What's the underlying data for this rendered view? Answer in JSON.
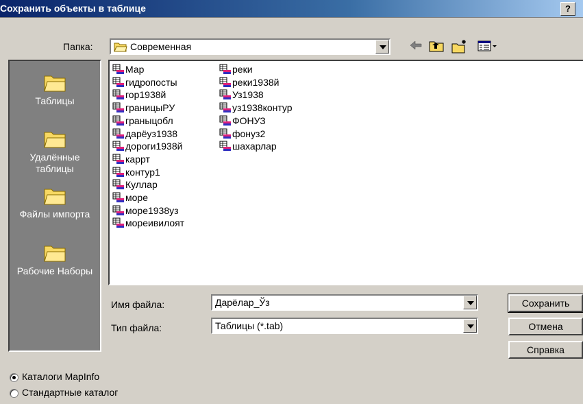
{
  "window": {
    "title": "Сохранить объекты в таблице",
    "help_label": "?"
  },
  "folder_bar": {
    "label": "Папка:",
    "current": "Современная"
  },
  "places": [
    {
      "name": "places-tables",
      "label": "Таблицы"
    },
    {
      "name": "places-remote",
      "label": "Удалённые таблицы"
    },
    {
      "name": "places-import",
      "label": "Файлы импорта"
    },
    {
      "name": "places-workspaces",
      "label": "Рабочие Наборы"
    }
  ],
  "files": {
    "column1": [
      "Мар",
      "гидропосты",
      "гор1938й",
      "границыРУ",
      "граныцобл",
      "дарёуз1938",
      "дороги1938й",
      "каррт",
      "контур1",
      "Куллар",
      "море",
      "море1938уз",
      "мореивилоят"
    ],
    "column2": [
      "реки",
      "реки1938й",
      "Уз1938",
      "уз1938контур",
      "ФОНУЗ",
      "фонуз2",
      "шахарлар"
    ]
  },
  "filename": {
    "label": "Имя файла:",
    "value": "Дарёлар_Ўз"
  },
  "filetype": {
    "label": "Тип файла:",
    "value": "Таблицы (*.tab)"
  },
  "buttons": {
    "save": "Сохранить",
    "cancel": "Отмена",
    "help": "Справка"
  },
  "catalog_options": [
    {
      "label": "Каталоги MapInfo",
      "selected": true
    },
    {
      "label": "Стандартные каталог",
      "selected": false
    }
  ]
}
